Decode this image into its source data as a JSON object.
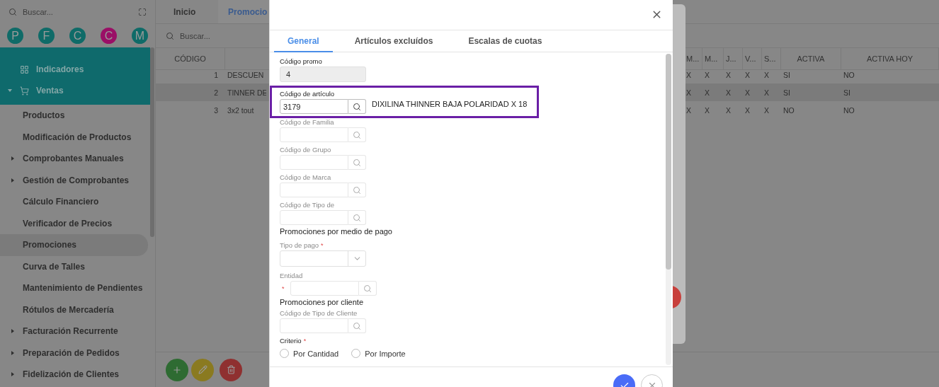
{
  "sidebar": {
    "search_placeholder": "Buscar...",
    "shortcuts": [
      {
        "letter": "P",
        "color": "#0f6b68"
      },
      {
        "letter": "F",
        "color": "#0f6b68"
      },
      {
        "letter": "C",
        "color": "#0f6b68"
      },
      {
        "letter": "C",
        "color": "#9a0f66"
      },
      {
        "letter": "M",
        "color": "#0f6b68"
      }
    ],
    "menu": [
      {
        "label": "Indicadores"
      },
      {
        "label": "Ventas",
        "expanded": true,
        "children": [
          {
            "label": "Productos",
            "kind": "link",
            "selected": false
          },
          {
            "label": "Modificación de Productos",
            "kind": "link",
            "selected": false
          },
          {
            "label": "Comprobantes Manuales",
            "kind": "folder",
            "expanded": false,
            "selected": false
          },
          {
            "label": "Gestión de Comprobantes",
            "kind": "folder",
            "expanded": false,
            "selected": false
          },
          {
            "label": "Cálculo Financiero",
            "kind": "link",
            "selected": false
          },
          {
            "label": "Verificador de Precios",
            "kind": "link",
            "selected": false
          },
          {
            "label": "Promociones",
            "kind": "link",
            "selected": true
          },
          {
            "label": "Curva de Talles",
            "kind": "link",
            "selected": false
          },
          {
            "label": "Mantenimiento de Pendientes",
            "kind": "link",
            "selected": false
          },
          {
            "label": "Rótulos de Mercadería",
            "kind": "link",
            "selected": false
          },
          {
            "label": "Facturación Recurrente",
            "kind": "folder",
            "expanded": false,
            "selected": false
          },
          {
            "label": "Preparación de Pedidos",
            "kind": "folder",
            "expanded": false,
            "selected": false
          },
          {
            "label": "Fidelización de Clientes",
            "kind": "folder",
            "expanded": false,
            "selected": false
          }
        ]
      }
    ]
  },
  "tabs": [
    {
      "label": "Inicio",
      "selected": false
    },
    {
      "label": "Promocio",
      "selected": true
    }
  ],
  "search": {
    "placeholder": "Buscar..."
  },
  "table": {
    "code_column": "CÓDIGO",
    "day_columns": [
      "M...",
      "M...",
      "J...",
      "V...",
      "S..."
    ],
    "active_column": "ACTIVA",
    "active_today_column": "ACTIVA HOY",
    "rows": [
      {
        "code": "1",
        "name": "DESCUEN",
        "days": [
          "X",
          "X",
          "X",
          "X",
          "X"
        ],
        "active": "SI",
        "active_today": "NO",
        "selected": false
      },
      {
        "code": "2",
        "name": "TINNER DE",
        "days": [
          "X",
          "X",
          "X",
          "X",
          "X"
        ],
        "active": "SI",
        "active_today": "SI",
        "selected": true
      },
      {
        "code": "3",
        "name": "3x2 tout",
        "days": [
          "X",
          "X",
          "X",
          "X",
          "X"
        ],
        "active": "NO",
        "active_today": "NO",
        "selected": false
      }
    ]
  },
  "dialog": {
    "tabs": [
      {
        "label": "General",
        "selected": true
      },
      {
        "label": "Artículos excluídos",
        "selected": false
      },
      {
        "label": "Escalas de cuotas",
        "selected": false
      }
    ],
    "fields": [
      {
        "kind": "text",
        "label": "Código promo",
        "value": "4"
      },
      {
        "kind": "lookup",
        "label": "Código de artículo",
        "value": "3179",
        "description": "DIXILINA THINNER BAJA POLARIDAD X 18",
        "highlighted": true,
        "disabled": false
      },
      {
        "kind": "lookup",
        "label": "Código de Familia",
        "disabled": true
      },
      {
        "kind": "lookup",
        "label": "Código de Grupo",
        "disabled": true
      },
      {
        "kind": "lookup",
        "label": "Código de Marca",
        "disabled": true
      },
      {
        "kind": "lookup",
        "label": "Código de Tipo de",
        "disabled": true
      },
      {
        "kind": "heading",
        "label": "Promociones por medio de pago"
      },
      {
        "kind": "select",
        "label": "Tipo de pago",
        "required_mark": "*",
        "disabled": true
      },
      {
        "kind": "lookup",
        "label": "Entidad",
        "required_mark": "*",
        "disabled": true
      },
      {
        "kind": "heading",
        "label": "Promociones por cliente"
      },
      {
        "kind": "lookup",
        "label": "Código de Tipo de Cliente",
        "disabled": true
      },
      {
        "kind": "radio",
        "label": "Criterio",
        "required_mark": "*",
        "disabled": false,
        "options": [
          {
            "label": "Por Cantidad",
            "selected": false
          },
          {
            "label": "Por Importe",
            "selected": false
          }
        ]
      }
    ]
  }
}
